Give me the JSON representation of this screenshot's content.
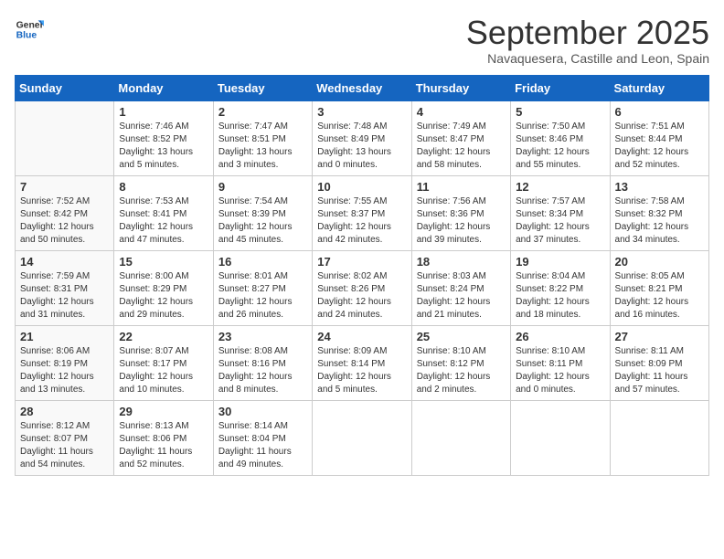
{
  "header": {
    "logo_line1": "General",
    "logo_line2": "Blue",
    "month": "September 2025",
    "location": "Navaquesera, Castille and Leon, Spain"
  },
  "days_of_week": [
    "Sunday",
    "Monday",
    "Tuesday",
    "Wednesday",
    "Thursday",
    "Friday",
    "Saturday"
  ],
  "weeks": [
    [
      {
        "day": "",
        "sunrise": "",
        "sunset": "",
        "daylight": ""
      },
      {
        "day": "1",
        "sunrise": "Sunrise: 7:46 AM",
        "sunset": "Sunset: 8:52 PM",
        "daylight": "Daylight: 13 hours and 5 minutes."
      },
      {
        "day": "2",
        "sunrise": "Sunrise: 7:47 AM",
        "sunset": "Sunset: 8:51 PM",
        "daylight": "Daylight: 13 hours and 3 minutes."
      },
      {
        "day": "3",
        "sunrise": "Sunrise: 7:48 AM",
        "sunset": "Sunset: 8:49 PM",
        "daylight": "Daylight: 13 hours and 0 minutes."
      },
      {
        "day": "4",
        "sunrise": "Sunrise: 7:49 AM",
        "sunset": "Sunset: 8:47 PM",
        "daylight": "Daylight: 12 hours and 58 minutes."
      },
      {
        "day": "5",
        "sunrise": "Sunrise: 7:50 AM",
        "sunset": "Sunset: 8:46 PM",
        "daylight": "Daylight: 12 hours and 55 minutes."
      },
      {
        "day": "6",
        "sunrise": "Sunrise: 7:51 AM",
        "sunset": "Sunset: 8:44 PM",
        "daylight": "Daylight: 12 hours and 52 minutes."
      }
    ],
    [
      {
        "day": "7",
        "sunrise": "Sunrise: 7:52 AM",
        "sunset": "Sunset: 8:42 PM",
        "daylight": "Daylight: 12 hours and 50 minutes."
      },
      {
        "day": "8",
        "sunrise": "Sunrise: 7:53 AM",
        "sunset": "Sunset: 8:41 PM",
        "daylight": "Daylight: 12 hours and 47 minutes."
      },
      {
        "day": "9",
        "sunrise": "Sunrise: 7:54 AM",
        "sunset": "Sunset: 8:39 PM",
        "daylight": "Daylight: 12 hours and 45 minutes."
      },
      {
        "day": "10",
        "sunrise": "Sunrise: 7:55 AM",
        "sunset": "Sunset: 8:37 PM",
        "daylight": "Daylight: 12 hours and 42 minutes."
      },
      {
        "day": "11",
        "sunrise": "Sunrise: 7:56 AM",
        "sunset": "Sunset: 8:36 PM",
        "daylight": "Daylight: 12 hours and 39 minutes."
      },
      {
        "day": "12",
        "sunrise": "Sunrise: 7:57 AM",
        "sunset": "Sunset: 8:34 PM",
        "daylight": "Daylight: 12 hours and 37 minutes."
      },
      {
        "day": "13",
        "sunrise": "Sunrise: 7:58 AM",
        "sunset": "Sunset: 8:32 PM",
        "daylight": "Daylight: 12 hours and 34 minutes."
      }
    ],
    [
      {
        "day": "14",
        "sunrise": "Sunrise: 7:59 AM",
        "sunset": "Sunset: 8:31 PM",
        "daylight": "Daylight: 12 hours and 31 minutes."
      },
      {
        "day": "15",
        "sunrise": "Sunrise: 8:00 AM",
        "sunset": "Sunset: 8:29 PM",
        "daylight": "Daylight: 12 hours and 29 minutes."
      },
      {
        "day": "16",
        "sunrise": "Sunrise: 8:01 AM",
        "sunset": "Sunset: 8:27 PM",
        "daylight": "Daylight: 12 hours and 26 minutes."
      },
      {
        "day": "17",
        "sunrise": "Sunrise: 8:02 AM",
        "sunset": "Sunset: 8:26 PM",
        "daylight": "Daylight: 12 hours and 24 minutes."
      },
      {
        "day": "18",
        "sunrise": "Sunrise: 8:03 AM",
        "sunset": "Sunset: 8:24 PM",
        "daylight": "Daylight: 12 hours and 21 minutes."
      },
      {
        "day": "19",
        "sunrise": "Sunrise: 8:04 AM",
        "sunset": "Sunset: 8:22 PM",
        "daylight": "Daylight: 12 hours and 18 minutes."
      },
      {
        "day": "20",
        "sunrise": "Sunrise: 8:05 AM",
        "sunset": "Sunset: 8:21 PM",
        "daylight": "Daylight: 12 hours and 16 minutes."
      }
    ],
    [
      {
        "day": "21",
        "sunrise": "Sunrise: 8:06 AM",
        "sunset": "Sunset: 8:19 PM",
        "daylight": "Daylight: 12 hours and 13 minutes."
      },
      {
        "day": "22",
        "sunrise": "Sunrise: 8:07 AM",
        "sunset": "Sunset: 8:17 PM",
        "daylight": "Daylight: 12 hours and 10 minutes."
      },
      {
        "day": "23",
        "sunrise": "Sunrise: 8:08 AM",
        "sunset": "Sunset: 8:16 PM",
        "daylight": "Daylight: 12 hours and 8 minutes."
      },
      {
        "day": "24",
        "sunrise": "Sunrise: 8:09 AM",
        "sunset": "Sunset: 8:14 PM",
        "daylight": "Daylight: 12 hours and 5 minutes."
      },
      {
        "day": "25",
        "sunrise": "Sunrise: 8:10 AM",
        "sunset": "Sunset: 8:12 PM",
        "daylight": "Daylight: 12 hours and 2 minutes."
      },
      {
        "day": "26",
        "sunrise": "Sunrise: 8:10 AM",
        "sunset": "Sunset: 8:11 PM",
        "daylight": "Daylight: 12 hours and 0 minutes."
      },
      {
        "day": "27",
        "sunrise": "Sunrise: 8:11 AM",
        "sunset": "Sunset: 8:09 PM",
        "daylight": "Daylight: 11 hours and 57 minutes."
      }
    ],
    [
      {
        "day": "28",
        "sunrise": "Sunrise: 8:12 AM",
        "sunset": "Sunset: 8:07 PM",
        "daylight": "Daylight: 11 hours and 54 minutes."
      },
      {
        "day": "29",
        "sunrise": "Sunrise: 8:13 AM",
        "sunset": "Sunset: 8:06 PM",
        "daylight": "Daylight: 11 hours and 52 minutes."
      },
      {
        "day": "30",
        "sunrise": "Sunrise: 8:14 AM",
        "sunset": "Sunset: 8:04 PM",
        "daylight": "Daylight: 11 hours and 49 minutes."
      },
      {
        "day": "",
        "sunrise": "",
        "sunset": "",
        "daylight": ""
      },
      {
        "day": "",
        "sunrise": "",
        "sunset": "",
        "daylight": ""
      },
      {
        "day": "",
        "sunrise": "",
        "sunset": "",
        "daylight": ""
      },
      {
        "day": "",
        "sunrise": "",
        "sunset": "",
        "daylight": ""
      }
    ]
  ]
}
